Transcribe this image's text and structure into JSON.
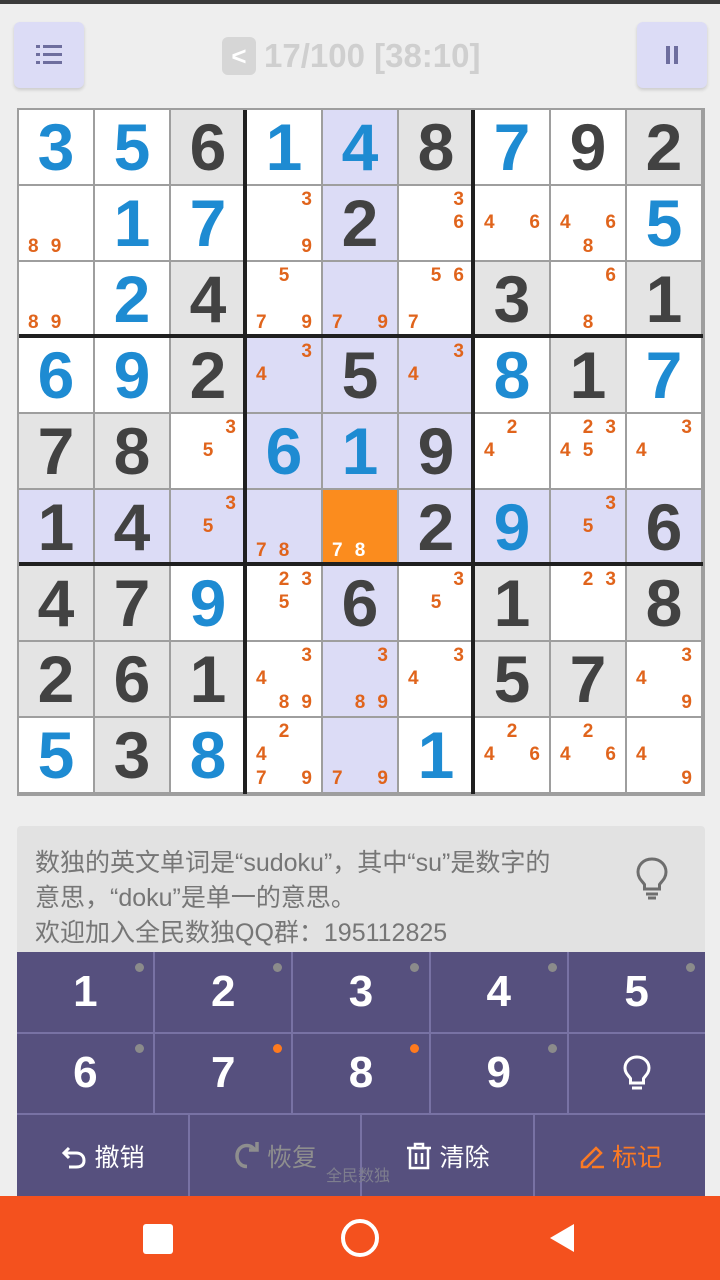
{
  "header": {
    "back_label": "<",
    "progress": "17/100 [38:10]"
  },
  "board": {
    "rows": [
      [
        {
          "v": "3",
          "t": "e",
          "b": "w"
        },
        {
          "v": "5",
          "t": "e",
          "b": "w"
        },
        {
          "v": "6",
          "t": "g",
          "b": "g"
        },
        {
          "v": "1",
          "t": "e",
          "b": "w"
        },
        {
          "v": "4",
          "t": "e",
          "b": "h"
        },
        {
          "v": "8",
          "t": "g",
          "b": "g"
        },
        {
          "v": "7",
          "t": "e",
          "b": "w"
        },
        {
          "v": "9",
          "t": "g",
          "b": "w"
        },
        {
          "v": "2",
          "t": "g",
          "b": "g"
        }
      ],
      [
        {
          "n": [
            "",
            "",
            "",
            "",
            "",
            "",
            "8",
            "9",
            ""
          ],
          "b": "w"
        },
        {
          "v": "1",
          "t": "e",
          "b": "w"
        },
        {
          "v": "7",
          "t": "e",
          "b": "w"
        },
        {
          "n": [
            "",
            "",
            "3",
            "",
            "",
            "",
            "",
            "",
            "9"
          ],
          "b": "w"
        },
        {
          "v": "2",
          "t": "g",
          "b": "h"
        },
        {
          "n": [
            "",
            "",
            "3",
            "",
            "",
            "6",
            "",
            "",
            ""
          ],
          "b": "w"
        },
        {
          "n": [
            "",
            "",
            "",
            "4",
            "",
            "6",
            "",
            "",
            ""
          ],
          "b": "w"
        },
        {
          "n": [
            "",
            "",
            "",
            "4",
            "",
            "6",
            "",
            "8",
            ""
          ],
          "b": "w"
        },
        {
          "v": "5",
          "t": "e",
          "b": "w"
        }
      ],
      [
        {
          "n": [
            "",
            "",
            "",
            "",
            "",
            "",
            "8",
            "9",
            ""
          ],
          "b": "w"
        },
        {
          "v": "2",
          "t": "e",
          "b": "w"
        },
        {
          "v": "4",
          "t": "g",
          "b": "g"
        },
        {
          "n": [
            "",
            "5",
            "",
            "",
            "",
            "",
            "7",
            "",
            "9"
          ],
          "b": "w"
        },
        {
          "n": [
            "",
            "",
            "",
            "",
            "",
            "",
            "7",
            "",
            "9"
          ],
          "b": "h"
        },
        {
          "n": [
            "",
            "5",
            "6",
            "",
            "",
            "",
            "7",
            "",
            ""
          ],
          "b": "w"
        },
        {
          "v": "3",
          "t": "g",
          "b": "g"
        },
        {
          "n": [
            "",
            "",
            "6",
            "",
            "",
            "",
            "",
            "8",
            ""
          ],
          "b": "w"
        },
        {
          "v": "1",
          "t": "g",
          "b": "g"
        }
      ],
      [
        {
          "v": "6",
          "t": "e",
          "b": "w"
        },
        {
          "v": "9",
          "t": "e",
          "b": "w"
        },
        {
          "v": "2",
          "t": "g",
          "b": "g"
        },
        {
          "n": [
            "",
            "",
            "3",
            "4",
            "",
            "",
            "",
            "",
            ""
          ],
          "b": "h"
        },
        {
          "v": "5",
          "t": "g",
          "b": "h"
        },
        {
          "n": [
            "",
            "",
            "3",
            "4",
            "",
            "",
            "",
            "",
            ""
          ],
          "b": "h"
        },
        {
          "v": "8",
          "t": "e",
          "b": "w"
        },
        {
          "v": "1",
          "t": "g",
          "b": "g"
        },
        {
          "v": "7",
          "t": "e",
          "b": "w"
        }
      ],
      [
        {
          "v": "7",
          "t": "g",
          "b": "g"
        },
        {
          "v": "8",
          "t": "g",
          "b": "g"
        },
        {
          "n": [
            "",
            "",
            "3",
            "",
            "5",
            "",
            "",
            "",
            ""
          ],
          "b": "w"
        },
        {
          "v": "6",
          "t": "e",
          "b": "h"
        },
        {
          "v": "1",
          "t": "e",
          "b": "h"
        },
        {
          "v": "9",
          "t": "g",
          "b": "h"
        },
        {
          "n": [
            "",
            "2",
            "",
            "4",
            "",
            "",
            "",
            "",
            ""
          ],
          "b": "w"
        },
        {
          "n": [
            "",
            "2",
            "3",
            "4",
            "5",
            "",
            "",
            "",
            ""
          ],
          "b": "w"
        },
        {
          "n": [
            "",
            "",
            "3",
            "4",
            "",
            "",
            "",
            "",
            ""
          ],
          "b": "w"
        }
      ],
      [
        {
          "v": "1",
          "t": "g",
          "b": "h"
        },
        {
          "v": "4",
          "t": "g",
          "b": "h"
        },
        {
          "n": [
            "",
            "",
            "3",
            "",
            "5",
            "",
            "",
            "",
            ""
          ],
          "b": "h"
        },
        {
          "n": [
            "",
            "",
            "",
            "",
            "",
            "",
            "7",
            "8",
            ""
          ],
          "b": "h"
        },
        {
          "n": [
            "",
            "",
            "",
            "",
            "",
            "",
            "7",
            "8",
            ""
          ],
          "b": "s"
        },
        {
          "v": "2",
          "t": "g",
          "b": "h"
        },
        {
          "v": "9",
          "t": "e",
          "b": "h"
        },
        {
          "n": [
            "",
            "",
            "3",
            "",
            "5",
            "",
            "",
            "",
            ""
          ],
          "b": "h"
        },
        {
          "v": "6",
          "t": "g",
          "b": "h"
        }
      ],
      [
        {
          "v": "4",
          "t": "g",
          "b": "g"
        },
        {
          "v": "7",
          "t": "g",
          "b": "g"
        },
        {
          "v": "9",
          "t": "e",
          "b": "w"
        },
        {
          "n": [
            "",
            "2",
            "3",
            "",
            "5",
            "",
            "",
            "",
            ""
          ],
          "b": "w"
        },
        {
          "v": "6",
          "t": "g",
          "b": "h"
        },
        {
          "n": [
            "",
            "",
            "3",
            "",
            "5",
            "",
            "",
            "",
            ""
          ],
          "b": "w"
        },
        {
          "v": "1",
          "t": "g",
          "b": "g"
        },
        {
          "n": [
            "",
            "2",
            "3",
            "",
            "",
            "",
            "",
            "",
            ""
          ],
          "b": "w"
        },
        {
          "v": "8",
          "t": "g",
          "b": "g"
        }
      ],
      [
        {
          "v": "2",
          "t": "g",
          "b": "g"
        },
        {
          "v": "6",
          "t": "g",
          "b": "g"
        },
        {
          "v": "1",
          "t": "g",
          "b": "g"
        },
        {
          "n": [
            "",
            "",
            "3",
            "4",
            "",
            "",
            "",
            "8",
            "9"
          ],
          "b": "w"
        },
        {
          "n": [
            "",
            "",
            "3",
            "",
            "",
            "",
            "",
            "8",
            "9"
          ],
          "b": "h"
        },
        {
          "n": [
            "",
            "",
            "3",
            "4",
            "",
            "",
            "",
            "",
            ""
          ],
          "b": "w"
        },
        {
          "v": "5",
          "t": "g",
          "b": "g"
        },
        {
          "v": "7",
          "t": "g",
          "b": "g"
        },
        {
          "n": [
            "",
            "",
            "3",
            "4",
            "",
            "",
            "",
            "",
            "9"
          ],
          "b": "w"
        }
      ],
      [
        {
          "v": "5",
          "t": "e",
          "b": "w"
        },
        {
          "v": "3",
          "t": "g",
          "b": "g"
        },
        {
          "v": "8",
          "t": "e",
          "b": "w"
        },
        {
          "n": [
            "",
            "2",
            "",
            "4",
            "",
            "",
            "7",
            "",
            "9"
          ],
          "b": "w"
        },
        {
          "n": [
            "",
            "",
            "",
            "",
            "",
            "",
            "7",
            "",
            "9"
          ],
          "b": "h"
        },
        {
          "v": "1",
          "t": "e",
          "b": "w"
        },
        {
          "n": [
            "",
            "2",
            "",
            "4",
            "",
            "6",
            "",
            "",
            ""
          ],
          "b": "w"
        },
        {
          "n": [
            "",
            "2",
            "",
            "4",
            "",
            "6",
            "",
            "",
            ""
          ],
          "b": "w"
        },
        {
          "n": [
            "",
            "",
            "",
            "4",
            "",
            "",
            "",
            "",
            "9"
          ],
          "b": "w"
        }
      ]
    ]
  },
  "hint": {
    "line1": "数独的英文单词是“sudoku”，其中“su”是数字的",
    "line2": "意思，“doku”是单一的意思。",
    "line3": "欢迎加入全民数独QQ群：195112825",
    "icon": "lightbulb-icon"
  },
  "keypad": {
    "keys": [
      {
        "label": "1",
        "dot": "gray"
      },
      {
        "label": "2",
        "dot": "gray"
      },
      {
        "label": "3",
        "dot": "gray"
      },
      {
        "label": "4",
        "dot": "gray"
      },
      {
        "label": "5",
        "dot": "gray"
      },
      {
        "label": "6",
        "dot": "gray"
      },
      {
        "label": "7",
        "dot": "orange"
      },
      {
        "label": "8",
        "dot": "orange"
      },
      {
        "label": "9",
        "dot": "gray"
      }
    ],
    "undo_label": "撤销",
    "redo_label": "恢复",
    "clear_label": "清除",
    "mark_label": "标记"
  },
  "watermark": "全民数独",
  "colors": {
    "given": "#424242",
    "entered": "#1e8bd2",
    "note": "#e0641c",
    "highlight": "#dcdcf6",
    "selected": "#fb8c1e",
    "keypad": "#56507e",
    "navbar": "#f4511e"
  }
}
